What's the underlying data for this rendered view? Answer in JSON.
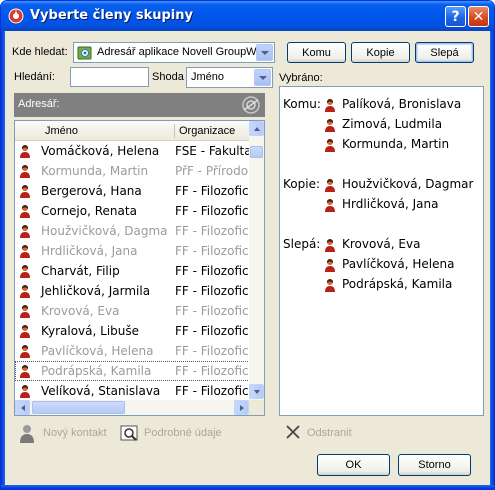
{
  "window": {
    "title": "Vyberte členy skupiny",
    "help_label": "?",
    "close_label": "✕"
  },
  "lookin": {
    "label": "Kde hledat:",
    "value": "Adresář aplikace Novell GroupWi"
  },
  "buttons": {
    "komu": "Komu",
    "kopie": "Kopie",
    "slepa": "Slepá",
    "ok": "OK",
    "cancel": "Storno"
  },
  "search": {
    "label": "Hledání:",
    "value": ""
  },
  "match": {
    "label": "Shoda",
    "value": "Jméno"
  },
  "selected_label": "Vybráno:",
  "addressbook_label": "Adresář:",
  "list": {
    "columns": {
      "name": "Jméno",
      "org": "Organizace"
    },
    "rows": [
      {
        "name": "Vomáčková, Helena",
        "org": "FSE - Fakulta",
        "dim": false
      },
      {
        "name": "Kormunda, Martin",
        "org": "PřF - Přírodo",
        "dim": true
      },
      {
        "name": "Bergerová, Hana",
        "org": "FF - Filozofic",
        "dim": false
      },
      {
        "name": "Cornejo, Renata",
        "org": "FF - Filozofic",
        "dim": false
      },
      {
        "name": "Houžvičková, Dagma",
        "org": "FF - Filozofic",
        "dim": true
      },
      {
        "name": "Hrdličková, Jana",
        "org": "FF - Filozofic",
        "dim": true
      },
      {
        "name": "Charvát, Filip",
        "org": "FF - Filozofic",
        "dim": false
      },
      {
        "name": "Jehličková, Jarmila",
        "org": "FF - Filozofic",
        "dim": false
      },
      {
        "name": "Krovová, Eva",
        "org": "FF - Filozofic",
        "dim": true
      },
      {
        "name": "Kyralová, Libuše",
        "org": "FF - Filozofic",
        "dim": false
      },
      {
        "name": "Pavlíčková, Helena",
        "org": "FF - Filozofic",
        "dim": true
      },
      {
        "name": "Podrápská, Kamila",
        "org": "FF - Filozofic",
        "dim": true
      },
      {
        "name": "Velíková, Stanislava",
        "org": "FF - Filozofic",
        "dim": false
      }
    ]
  },
  "selected": {
    "komu": {
      "label": "Komu:",
      "names": [
        "Palíková, Bronislava",
        "Zimová, Ludmila",
        "Kormunda, Martin"
      ]
    },
    "kopie": {
      "label": "Kopie:",
      "names": [
        "Houžvičková, Dagmar",
        "Hrdličková, Jana"
      ]
    },
    "slepa": {
      "label": "Slepá:",
      "names": [
        "Krovová, Eva",
        "Pavlíčková, Helena",
        "Podrápská, Kamila"
      ]
    }
  },
  "actions": {
    "new_contact": "Nový kontakt",
    "details": "Podrobné údaje",
    "remove": "Odstranit"
  },
  "colors": {
    "title_bar": "#0058ee",
    "dialog_bg": "#ece9d8",
    "dim_text": "#9b9b9b",
    "disabled_text": "#aca899"
  },
  "icons": {
    "app": "groupwise-app-icon",
    "person": "person-icon",
    "addressbook": "addressbook-icon",
    "new_contact": "new-contact-icon",
    "details": "details-icon",
    "remove": "remove-icon"
  }
}
